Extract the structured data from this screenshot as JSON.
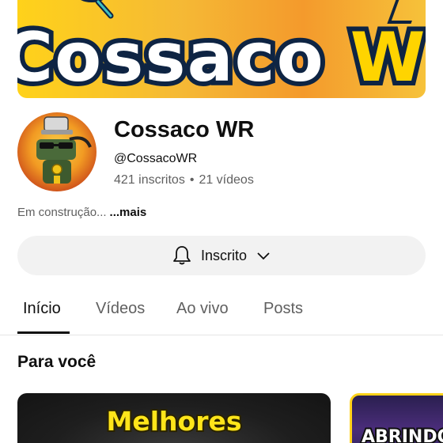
{
  "banner": {
    "title_main": "Cossaco ",
    "title_accent": "W"
  },
  "channel": {
    "name": "Cossaco WR",
    "handle": "@CossacoWR",
    "subscribers": "421 inscritos",
    "separator": "•",
    "videos": "21 vídeos",
    "description": "Em construção...",
    "more_link": "...mais"
  },
  "subscribe": {
    "label": "Inscrito",
    "bell_icon": "bell-icon",
    "chevron_icon": "chevron-down-icon"
  },
  "tabs": [
    {
      "label": "Início",
      "active": true
    },
    {
      "label": "Vídeos",
      "active": false
    },
    {
      "label": "Ao vivo",
      "active": false
    },
    {
      "label": "Posts",
      "active": false
    }
  ],
  "section": {
    "title": "Para você"
  },
  "videos": [
    {
      "thumb_text": "Melhores"
    },
    {
      "thumb_text": "ABRINDO"
    }
  ],
  "colors": {
    "banner_yellow": "#ffd21a",
    "banner_orange": "#f49a2c",
    "banner_stroke": "#0e2443",
    "thumb_text": "#ffe51a"
  }
}
